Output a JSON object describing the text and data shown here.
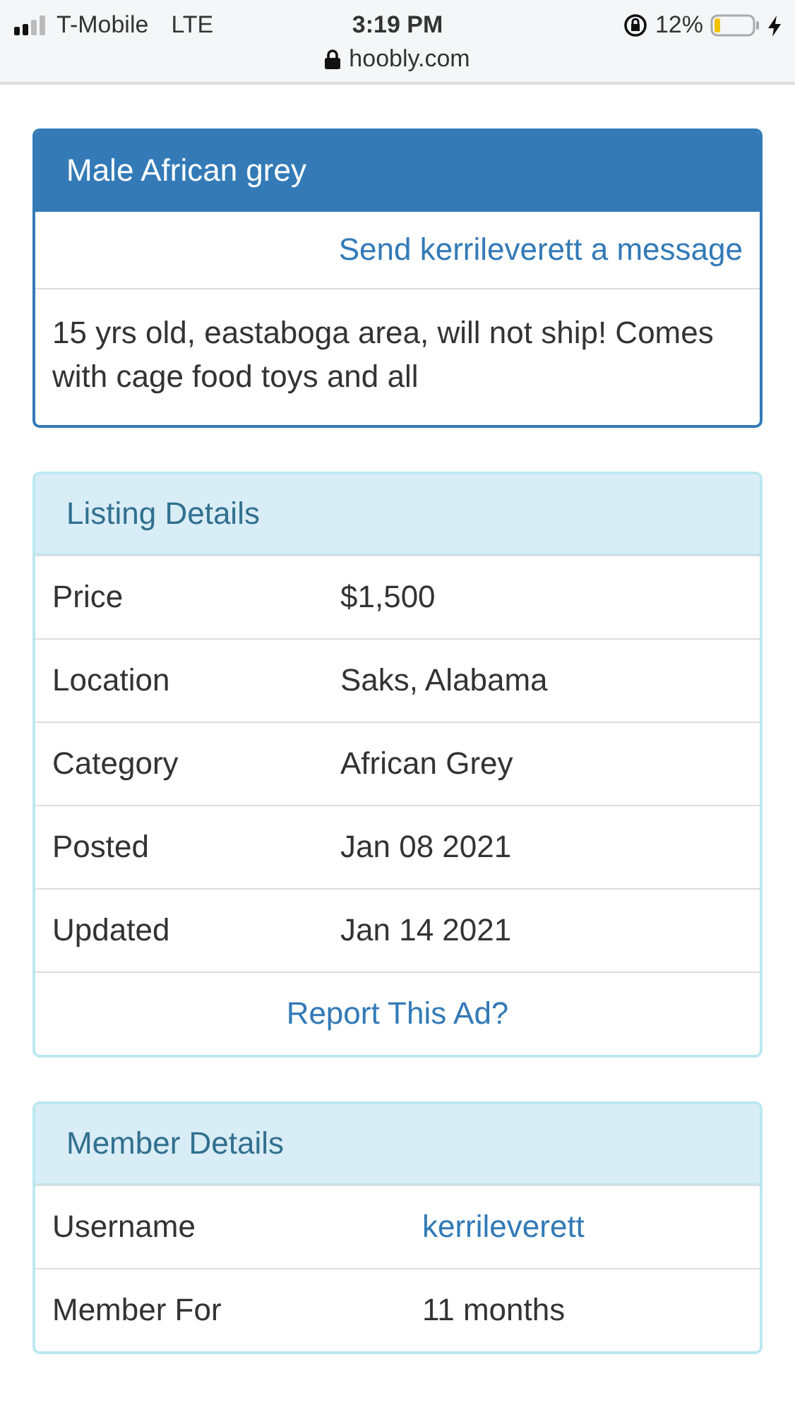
{
  "status_bar": {
    "carrier": "T-Mobile",
    "network": "LTE",
    "time": "3:19 PM",
    "battery": "12%",
    "url": "hoobly.com"
  },
  "ad": {
    "title": "Male African grey",
    "message_link": "Send kerrileverett a message",
    "description": "15 yrs old, eastaboga area, will not ship! Comes with cage food toys and all"
  },
  "listing_details": {
    "title": "Listing Details",
    "rows": [
      {
        "label": "Price",
        "value": "$1,500"
      },
      {
        "label": "Location",
        "value": "Saks, Alabama"
      },
      {
        "label": "Category",
        "value": "African Grey"
      },
      {
        "label": "Posted",
        "value": "Jan 08 2021"
      },
      {
        "label": "Updated",
        "value": "Jan 14 2021"
      }
    ],
    "report_link": "Report This Ad?"
  },
  "member_details": {
    "title": "Member Details",
    "rows": [
      {
        "label": "Username",
        "value": "kerrileverett",
        "kind": "link"
      },
      {
        "label": "Member For",
        "value": "11 months",
        "kind": "text"
      }
    ]
  }
}
